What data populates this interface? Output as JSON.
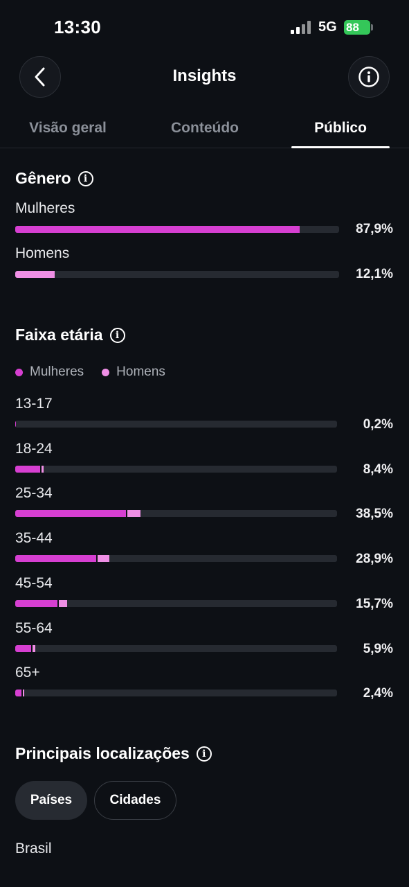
{
  "status_bar": {
    "time": "13:30",
    "network": "5G",
    "battery": "88"
  },
  "header": {
    "title": "Insights",
    "back_icon": "chevron-left-icon",
    "info_icon": "info-icon"
  },
  "tabs": [
    {
      "label": "Visão geral",
      "active": false
    },
    {
      "label": "Conteúdo",
      "active": false
    },
    {
      "label": "Público",
      "active": true
    }
  ],
  "gender": {
    "title": "Gênero",
    "rows": [
      {
        "label": "Mulheres",
        "value": "87,9%",
        "fraction": 0.879,
        "kind": "women"
      },
      {
        "label": "Homens",
        "value": "12,1%",
        "fraction": 0.121,
        "kind": "men"
      }
    ]
  },
  "age": {
    "title": "Faixa etária",
    "legend": [
      {
        "label": "Mulheres",
        "color": "#d63fd1"
      },
      {
        "label": "Homens",
        "color": "#ef8fe5"
      }
    ],
    "rows": [
      {
        "label": "13-17",
        "value": "0,2%",
        "women": 0.002,
        "men": 0.0
      },
      {
        "label": "18-24",
        "value": "8,4%",
        "women": 0.077,
        "men": 0.007
      },
      {
        "label": "25-34",
        "value": "38,5%",
        "women": 0.345,
        "men": 0.04
      },
      {
        "label": "35-44",
        "value": "28,9%",
        "women": 0.252,
        "men": 0.037
      },
      {
        "label": "45-54",
        "value": "15,7%",
        "women": 0.132,
        "men": 0.025
      },
      {
        "label": "55-64",
        "value": "5,9%",
        "women": 0.05,
        "men": 0.009
      },
      {
        "label": "65+",
        "value": "2,4%",
        "women": 0.02,
        "men": 0.004
      }
    ]
  },
  "locations": {
    "title": "Principais localizações",
    "tabs": [
      {
        "label": "Países",
        "selected": true
      },
      {
        "label": "Cidades",
        "selected": false
      }
    ],
    "items": [
      "Brasil"
    ]
  },
  "colors": {
    "women": "#d63fd1",
    "men": "#ef8fe5",
    "track": "#262a31",
    "background": "#0d1015"
  }
}
